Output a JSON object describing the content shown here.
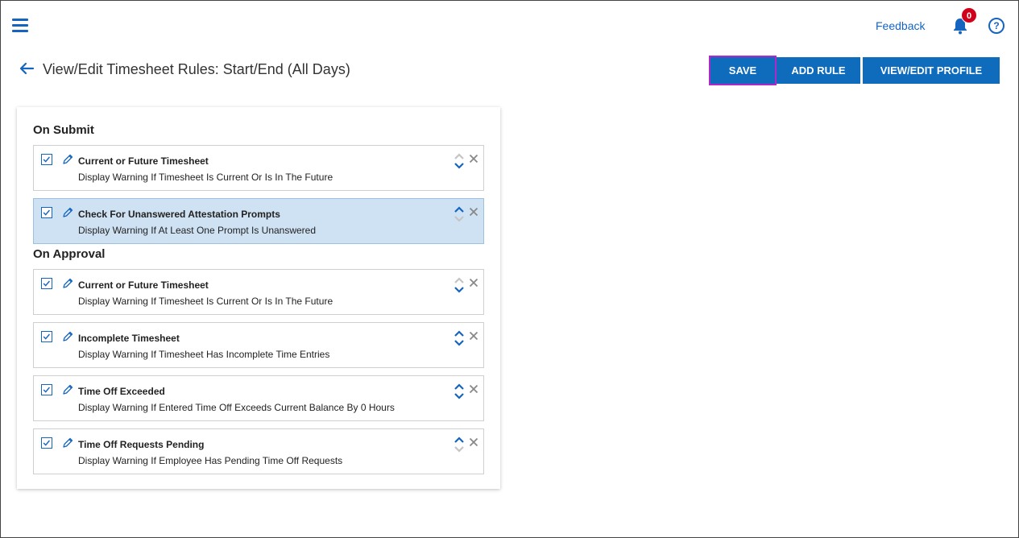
{
  "header": {
    "feedback_label": "Feedback",
    "notification_count": "0",
    "help_label": "?"
  },
  "page": {
    "title": "View/Edit Timesheet Rules: Start/End (All Days)"
  },
  "toolbar": {
    "save_label": "SAVE",
    "add_rule_label": "ADD RULE",
    "view_edit_profile_label": "VIEW/EDIT PROFILE"
  },
  "colors": {
    "accent": "#0f6cbd",
    "highlight_outline": "#b026c9",
    "selected_row": "#cfe2f3",
    "badge": "#d0021b"
  },
  "sections": [
    {
      "title": "On Submit",
      "rules": [
        {
          "title": "Current or Future Timesheet",
          "description": "Display Warning If Timesheet Is Current Or Is In The Future",
          "checked": true,
          "selected": false,
          "can_move_up": false,
          "can_move_down": true
        },
        {
          "title": "Check For Unanswered Attestation Prompts",
          "description": "Display Warning If At Least One Prompt Is Unanswered",
          "checked": true,
          "selected": true,
          "can_move_up": true,
          "can_move_down": false
        }
      ]
    },
    {
      "title": "On Approval",
      "rules": [
        {
          "title": "Current or Future Timesheet",
          "description": "Display Warning If Timesheet Is Current Or Is In The Future",
          "checked": true,
          "selected": false,
          "can_move_up": false,
          "can_move_down": true
        },
        {
          "title": "Incomplete Timesheet",
          "description": "Display Warning If Timesheet Has Incomplete Time Entries",
          "checked": true,
          "selected": false,
          "can_move_up": true,
          "can_move_down": true
        },
        {
          "title": "Time Off Exceeded",
          "description": "Display Warning If Entered Time Off Exceeds Current Balance By 0 Hours",
          "checked": true,
          "selected": false,
          "can_move_up": true,
          "can_move_down": true
        },
        {
          "title": "Time Off Requests Pending",
          "description": "Display Warning If Employee Has Pending Time Off Requests",
          "checked": true,
          "selected": false,
          "can_move_up": true,
          "can_move_down": false
        }
      ]
    }
  ]
}
